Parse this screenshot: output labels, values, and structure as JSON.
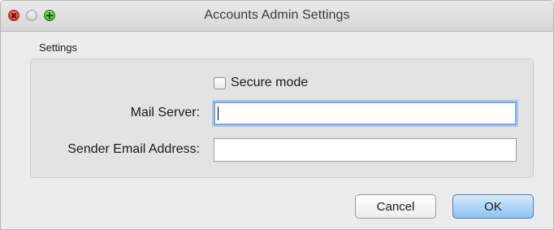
{
  "window": {
    "title": "Accounts Admin Settings"
  },
  "settings": {
    "section_label": "Settings",
    "secure_mode": {
      "label": "Secure mode",
      "checked": false
    },
    "mail_server": {
      "label": "Mail Server:",
      "value": "",
      "focused": true
    },
    "sender_email": {
      "label": "Sender Email Address:",
      "value": ""
    }
  },
  "buttons": {
    "cancel_label": "Cancel",
    "ok_label": "OK"
  },
  "colors": {
    "focus_ring": "#7aaae6",
    "default_button": "#8cc2f2"
  }
}
